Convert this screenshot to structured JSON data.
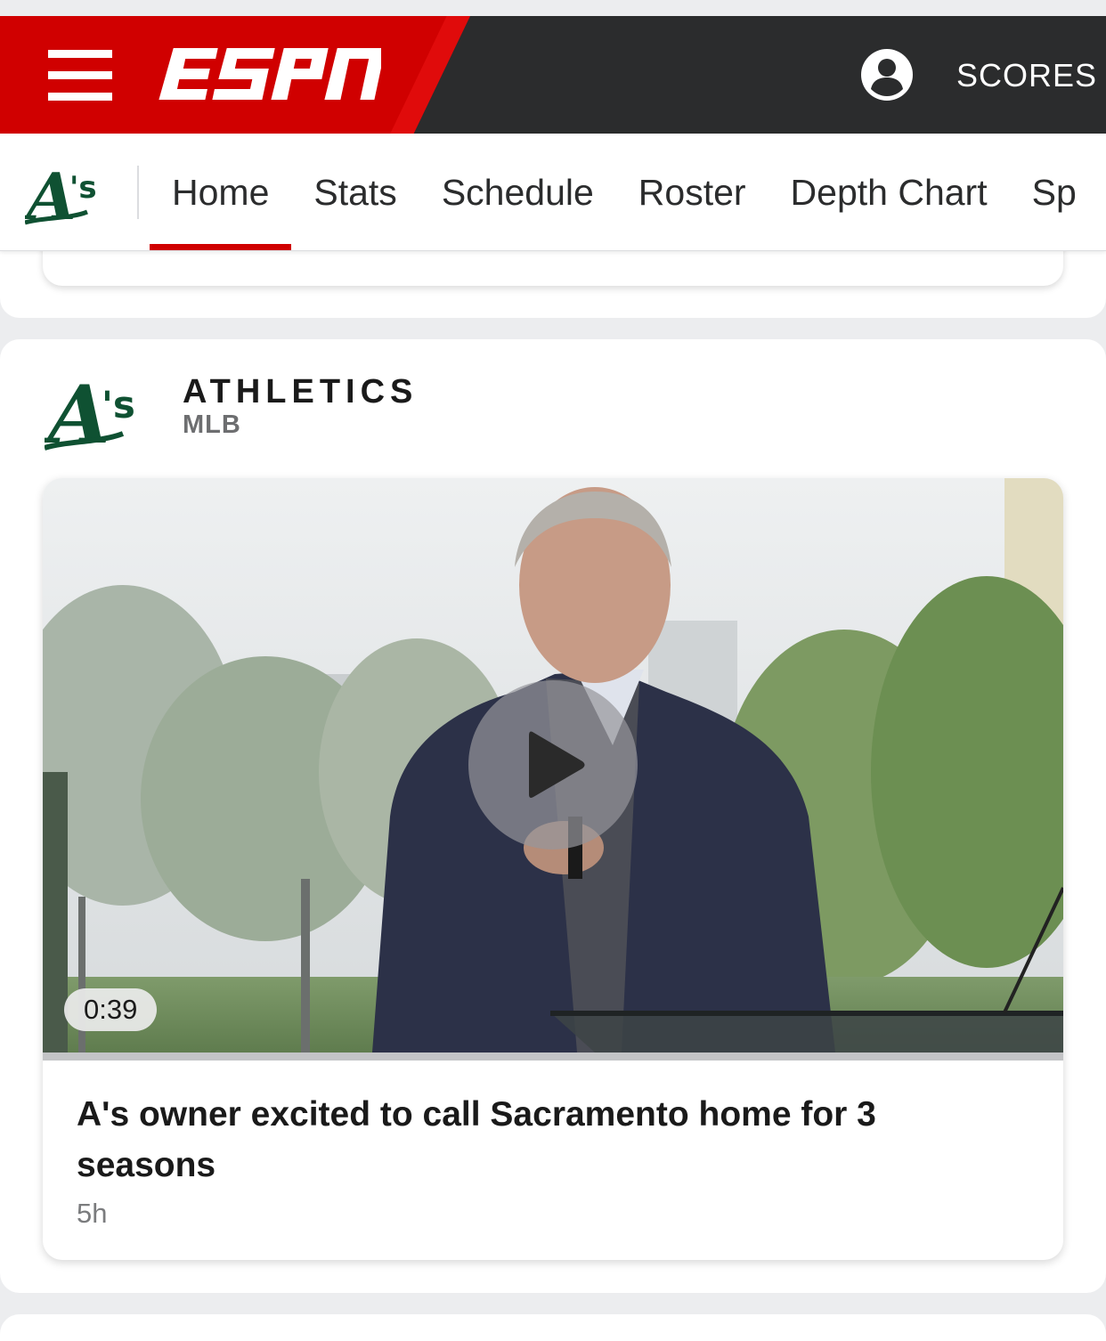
{
  "header": {
    "brand": "ESPN",
    "scores_label": "SCORES"
  },
  "team_nav": {
    "logo_text": "A's",
    "tabs": [
      {
        "label": "Home",
        "active": true
      },
      {
        "label": "Stats"
      },
      {
        "label": "Schedule"
      },
      {
        "label": "Roster"
      },
      {
        "label": "Depth Chart"
      },
      {
        "label": "Sp"
      }
    ]
  },
  "section": {
    "team_name": "ATHLETICS",
    "league": "MLB",
    "card": {
      "duration": "0:39",
      "headline": "A's owner excited to call Sacramento home for 3 seasons",
      "time_ago": "5h"
    }
  },
  "colors": {
    "espn_red": "#d00000",
    "bar_dark": "#2b2c2d",
    "athletics_green": "#0f5132"
  }
}
